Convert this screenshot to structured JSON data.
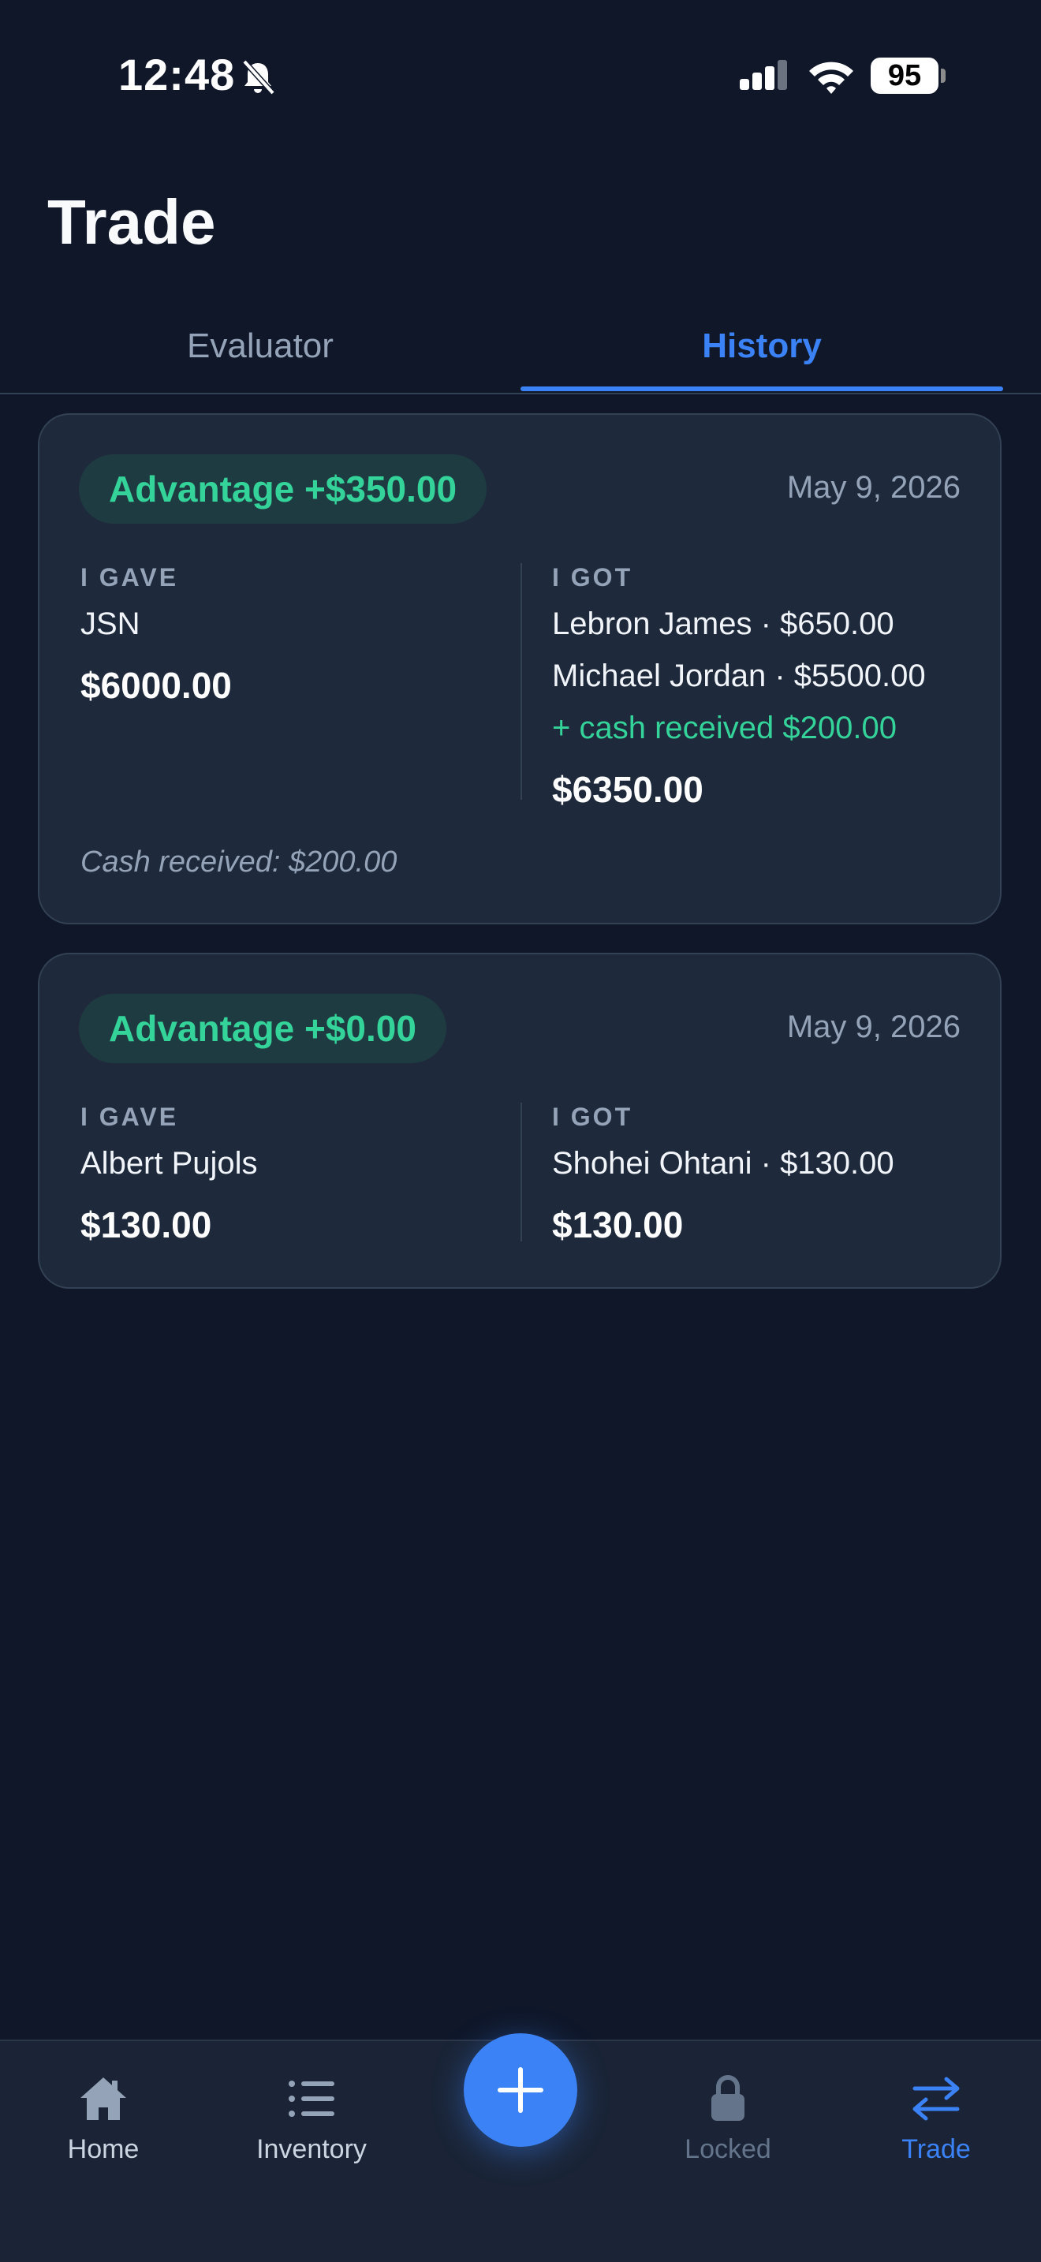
{
  "status_bar": {
    "time": "12:48",
    "battery": "95"
  },
  "header": {
    "title": "Trade"
  },
  "tabs": [
    {
      "label": "Evaluator",
      "active": false
    },
    {
      "label": "History",
      "active": true
    }
  ],
  "trades": [
    {
      "badge": "Advantage +$350.00",
      "date": "May 9, 2026",
      "gave_label": "I GAVE",
      "gave_items": [
        "JSN"
      ],
      "gave_total": "$6000.00",
      "got_label": "I GOT",
      "got_items": [
        "Lebron James · $650.00",
        "Michael Jordan · $5500.00"
      ],
      "got_cash": "+ cash received $200.00",
      "got_total": "$6350.00",
      "note": "Cash received: $200.00"
    },
    {
      "badge": "Advantage +$0.00",
      "date": "May 9, 2026",
      "gave_label": "I GAVE",
      "gave_items": [
        "Albert Pujols"
      ],
      "gave_total": "$130.00",
      "got_label": "I GOT",
      "got_items": [
        "Shohei Ohtani · $130.00"
      ],
      "got_total": "$130.00"
    }
  ],
  "nav": {
    "home": "Home",
    "inventory": "Inventory",
    "locked": "Locked",
    "trade": "Trade"
  },
  "colors": {
    "background": "#0f1729",
    "card": "#1e293b",
    "accent": "#3b82f6",
    "positive": "#34d399",
    "muted": "#94a3b8"
  }
}
